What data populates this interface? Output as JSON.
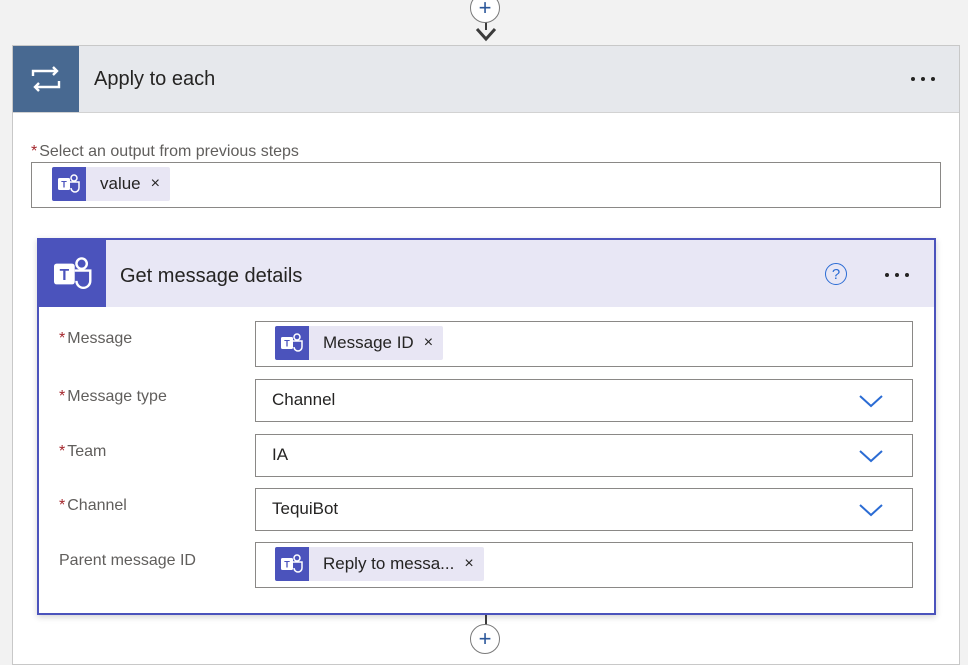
{
  "colors": {
    "teams_purple": "#4b53bc",
    "loop_blue": "#486991",
    "chevron_blue": "#2b6cd4",
    "required_red": "#a4262c"
  },
  "loop": {
    "title": "Apply to each",
    "icon": "loop-icon",
    "more_icon": "more-icon",
    "output_label": "Select an output from previous steps",
    "output_required": "*",
    "output_token": {
      "label": "value",
      "remove": "×",
      "icon": "teams-icon"
    }
  },
  "action": {
    "title": "Get message details",
    "icon": "teams-icon",
    "help_icon": "help-icon",
    "help_glyph": "?",
    "more_icon": "more-icon",
    "fields": {
      "message": {
        "required": "*",
        "label": "Message",
        "token": "Message ID",
        "remove": "×"
      },
      "message_type": {
        "required": "*",
        "label": "Message type",
        "value": "Channel"
      },
      "team": {
        "required": "*",
        "label": "Team",
        "value": "IA"
      },
      "channel": {
        "required": "*",
        "label": "Channel",
        "value": "TequiBot"
      },
      "parent_message_id": {
        "label": "Parent message ID",
        "token": "Reply to messa...",
        "remove": "×"
      }
    }
  },
  "connectors": {
    "add_glyph": "+"
  }
}
